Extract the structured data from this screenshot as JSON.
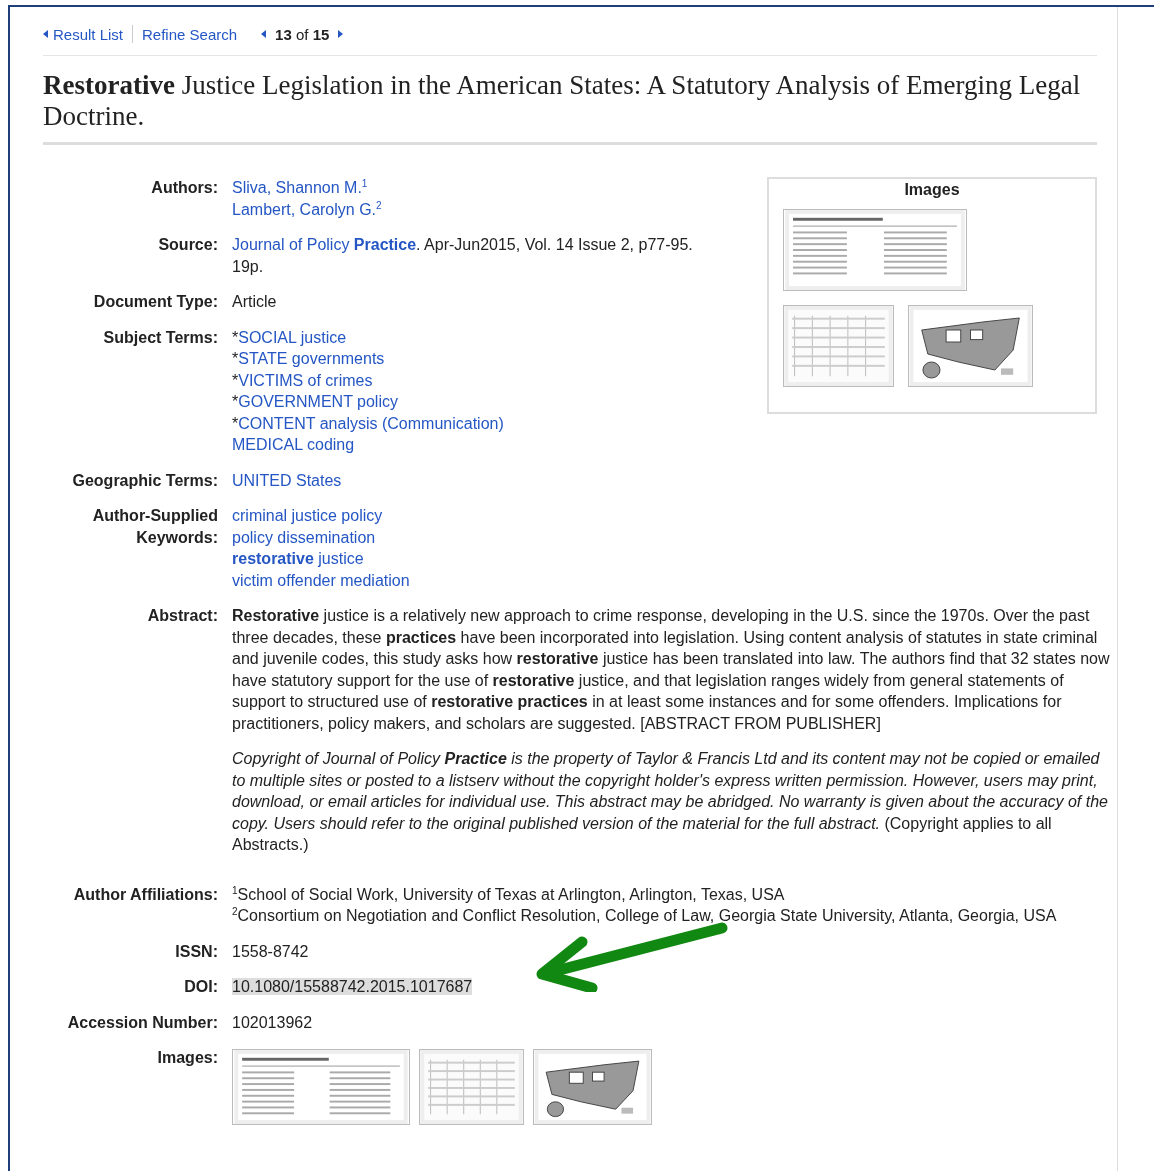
{
  "nav": {
    "links": [
      {
        "label": "Result List",
        "kind": "back"
      },
      {
        "label": "Refine Search",
        "kind": "plain"
      }
    ],
    "pager": "**13** of **15**"
  },
  "title": "**Restorative** Justice Legislation in the American States: A Statutory Analysis of Emerging Legal Doctrine.",
  "images_panel": {
    "title": "Images"
  },
  "fields": [
    {
      "label": "Authors:",
      "kind": "links",
      "items": [
        {
          "text": "Sliva, Shannon M.$^{1}$"
        },
        {
          "text": "Lambert, Carolyn G.$^{2}$"
        }
      ]
    },
    {
      "label": "Source:",
      "kind": "source",
      "link": "Journal of Policy **Practice**",
      "text": ". Apr-Jun2015, Vol. 14 Issue 2, p77-95. 19p."
    },
    {
      "label": "Document Type:",
      "kind": "text",
      "text": "Article"
    },
    {
      "label": "Subject Terms:",
      "kind": "links",
      "items": [
        {
          "prefix": "*",
          "text": "SOCIAL justice"
        },
        {
          "prefix": "*",
          "text": "STATE governments"
        },
        {
          "prefix": "*",
          "text": "VICTIMS of crimes"
        },
        {
          "prefix": "*",
          "text": "GOVERNMENT policy"
        },
        {
          "prefix": "*",
          "text": "CONTENT analysis (Communication)"
        },
        {
          "text": "MEDICAL coding"
        }
      ]
    },
    {
      "label": "Geographic Terms:",
      "kind": "links",
      "items": [
        {
          "text": "UNITED States"
        }
      ]
    },
    {
      "label": "Author-Supplied Keywords:",
      "kind": "links",
      "items": [
        {
          "text": "criminal justice policy"
        },
        {
          "text": "policy dissemination"
        },
        {
          "text": "**restorative** justice"
        },
        {
          "text": "victim offender mediation"
        }
      ]
    },
    {
      "label": "Abstract:",
      "kind": "paragraphs",
      "paragraphs": [
        "**Restorative** justice is a relatively new approach to crime response, developing in the U.S. since the 1970s. Over the past three decades, these **practices** have been incorporated into legislation. Using content analysis of statutes in state criminal and juvenile codes, this study asks how **restorative** justice has been translated into law. The authors find that 32 states now have statutory support for the use of **restorative** justice, and that legislation ranges widely from general statements of support to structured use of **restorative practices** in at least some instances and for some offenders. Implications for practitioners, policy makers, and scholars are suggested. [ABSTRACT FROM PUBLISHER]",
        {
          "italic": "Copyright of Journal of Policy **Practice** is the property of Taylor & Francis Ltd and its content may not be copied or emailed to multiple sites or posted to a listserv without the copyright holder's express written permission. However, users may print, download, or email articles for individual use. This abstract may be abridged. No warranty is given about the accuracy of the copy. Users should refer to the original published version of the material for the full abstract.",
          "plain": "(Copyright applies to all Abstracts.)"
        }
      ]
    },
    {
      "label": "Author Affiliations:",
      "kind": "lines",
      "items": [
        "$^{1}$School of Social Work, University of Texas at Arlington, Arlington, Texas, USA",
        "$^{2}$Consortium on Negotiation and Conflict Resolution, College of Law, Georgia State University, Atlanta, Georgia, USA"
      ]
    },
    {
      "label": "ISSN:",
      "kind": "text",
      "text": "1558-8742"
    },
    {
      "label": "DOI:",
      "kind": "highlight",
      "text": "10.1080/15588742.2015.1017687"
    },
    {
      "label": "Accession Number:",
      "kind": "text",
      "text": "102013962"
    },
    {
      "label": "Images:",
      "kind": "images"
    }
  ]
}
